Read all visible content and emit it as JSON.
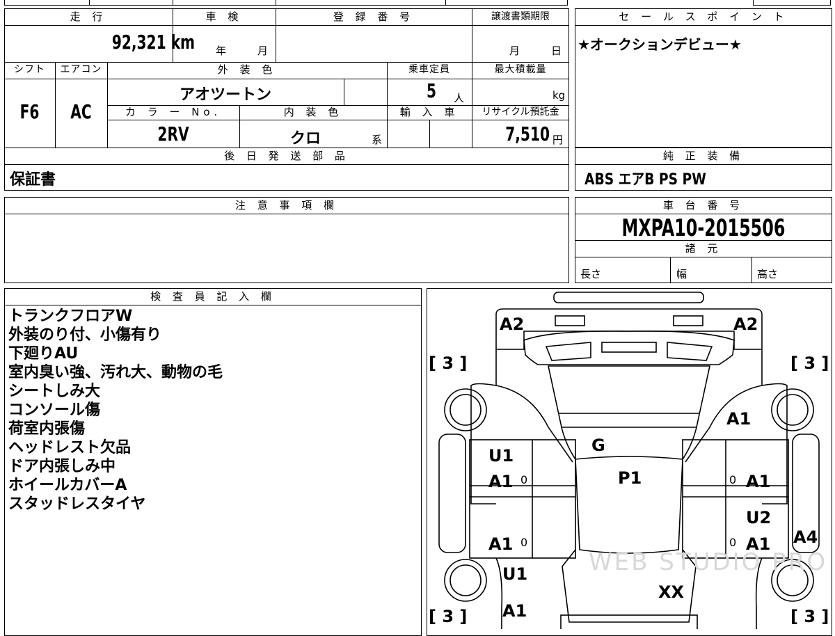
{
  "summary": {
    "mileage_header": "走 行",
    "mileage": "92,321 km",
    "inspection_header": "車 検",
    "inspection_year_unit": "年",
    "inspection_month_unit": "月",
    "registration_header": "登 録 番 号",
    "transfer_header": "譲渡書類期限",
    "transfer_month_unit": "月",
    "transfer_day_unit": "日",
    "shift_header": "シフト",
    "shift": "F6",
    "ac_header": "エアコン",
    "ac": "AC",
    "exterior_color_header": "外 装 色",
    "exterior_color": "アオツートン",
    "capacity_header": "乗車定員",
    "capacity": "5",
    "capacity_unit": "人",
    "max_load_header": "最大積載量",
    "max_load_unit": "kg",
    "color_no_header": "カ ラ ー No.",
    "color_no": "2RV",
    "interior_color_header": "内 装 色",
    "interior_color": "クロ",
    "interior_color_suffix": "系",
    "import_header": "輸 入 車",
    "recycle_header": "リサイクル預託金",
    "recycle_fee": "7,510",
    "recycle_unit": "円",
    "later_parts_header": "後 日 発 送 部 品",
    "later_parts": "保証書"
  },
  "sales_point": {
    "header": "セ ー ル ス ポ イ ン ト",
    "text": "★オークションデビュー★"
  },
  "equipment": {
    "header": "純 正 装 備",
    "text": "ABS エアB PS PW"
  },
  "notes": {
    "header": "注 意 事 項 欄",
    "text": ""
  },
  "chassis": {
    "header": "車 台 番 号",
    "number": "MXPA10-2015506",
    "specs_header": "諸 元",
    "length_label": "長さ",
    "width_label": "幅",
    "height_label": "高さ"
  },
  "inspector": {
    "header": "検 査 員 記 入 欄",
    "remarks": [
      "トランクフロアW",
      "外装のり付、小傷有り",
      "下廻りAU",
      "室内臭い強、汚れ大、動物の毛",
      "シートしみ大",
      "コンソール傷",
      "荷室内張傷",
      "ヘッドレスト欠品",
      "ドア内張しみ中",
      "ホイールカバーA",
      "スタッドレスタイヤ"
    ]
  },
  "diagram": {
    "marks": {
      "rear_left": "A2",
      "rear_right": "A2",
      "right_quarter": "A1",
      "rear_glass": "G",
      "left_rear_door_u": "U1",
      "left_rear_door_a": "A1",
      "roof": "P1",
      "right_rear_door": "A1",
      "right_front_door_u": "U2",
      "right_front_door_a": "A1",
      "left_front_door": "A1",
      "right_rocker": "A4",
      "left_fender_u": "U1",
      "hood": "XX",
      "left_front_a": "A1"
    },
    "tread_rear_left": "[ 3 ]",
    "tread_rear_right": "[ 3 ]",
    "tread_front_left": "[ 3 ]",
    "tread_front_right": "[ 3 ]",
    "zero": "0",
    "watermark": "WEB STUDIO PRO"
  }
}
